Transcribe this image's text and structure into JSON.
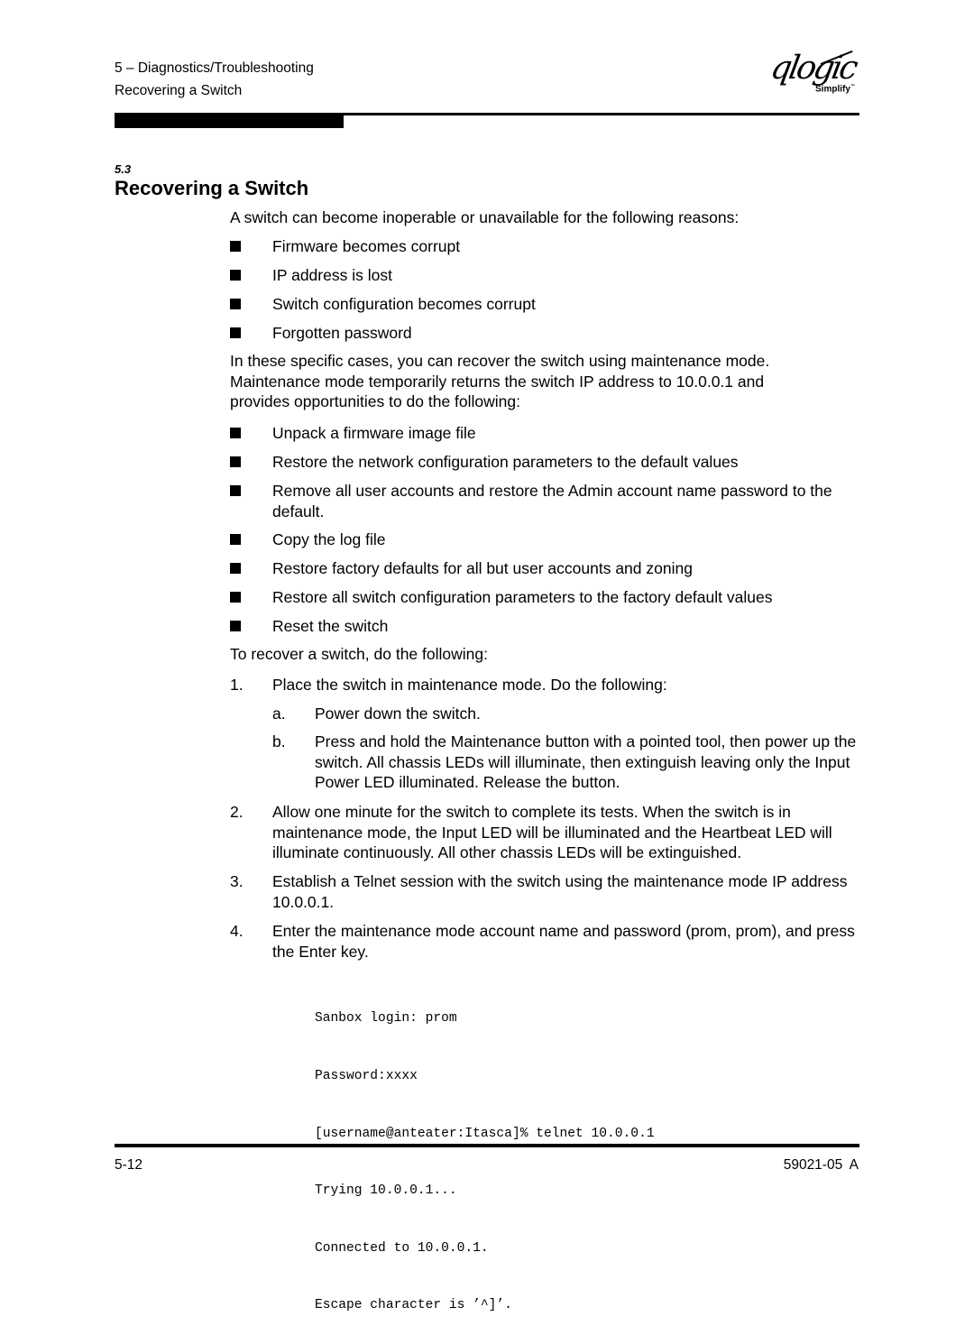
{
  "header": {
    "chapter": "5 – Diagnostics/Troubleshooting",
    "section": "Recovering a Switch",
    "logo": {
      "icon": "qlogic-logo",
      "wordmark": "qlogic",
      "tagline": "Simplify",
      "trademark": "™"
    }
  },
  "section": {
    "number": "5.3",
    "title": "Recovering a Switch"
  },
  "content": {
    "intro": "A switch can become inoperable or unavailable for the following reasons:",
    "reasons": [
      "Firmware becomes corrupt",
      "IP address is lost",
      "Switch configuration becomes corrupt",
      "Forgotten password"
    ],
    "maintenance_paragraph": [
      "In these specific cases, you can recover the switch using maintenance mode.",
      "Maintenance mode temporarily returns the switch IP address to 10.0.0.1 and",
      "provides opportunities to do the following:"
    ],
    "opportunities": [
      "Unpack a firmware image file",
      "Restore the network configuration parameters to the default values",
      "Remove all user accounts and restore the Admin account name password to the default.",
      "Copy the log file",
      "Restore factory defaults for all but user accounts and zoning",
      "Restore all switch configuration parameters to the factory default values",
      "Reset the switch"
    ],
    "procedure_intro": "To recover a switch, do the following:",
    "steps": [
      {
        "num": "1.",
        "text": "Place the switch in maintenance mode. Do the following:",
        "substeps": [
          {
            "num": "a.",
            "text": "Power down the switch."
          },
          {
            "num": "b.",
            "text": "Press and hold the Maintenance button with a pointed tool, then power up the switch. All chassis LEDs will illuminate, then extinguish leaving only the Input Power LED illuminated. Release the button."
          }
        ]
      },
      {
        "num": "2.",
        "text": "Allow one minute for the switch to complete its tests. When the switch is in maintenance mode, the Input LED will be illuminated and the Heartbeat LED will illuminate continuously. All other chassis LEDs will be extinguished."
      },
      {
        "num": "3.",
        "text": "Establish a Telnet session with the switch using the maintenance mode IP address 10.0.0.1."
      },
      {
        "num": "4.",
        "text": "Enter the maintenance mode account name and password (prom, prom), and press the Enter key."
      }
    ],
    "code_lines": [
      "Sanbox login: prom",
      "Password:xxxx",
      "[username@anteater:Itasca]% telnet 10.0.0.1",
      "Trying 10.0.0.1...",
      "Connected to 10.0.0.1.",
      "Escape character is ’^]’."
    ]
  },
  "footer": {
    "page_number": "5-12",
    "doc_id": "59021-05 A"
  }
}
